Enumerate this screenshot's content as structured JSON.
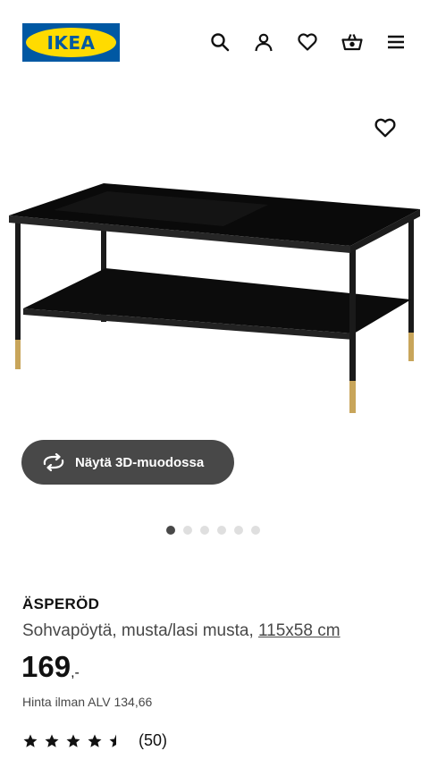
{
  "header": {
    "logo_text": "IKEA",
    "icons": [
      "search-icon",
      "profile-icon",
      "heart-icon",
      "basket-icon",
      "menu-icon"
    ]
  },
  "gallery": {
    "image_alt": "ÄSPERÖD Sohvapöytä, musta/lasi musta",
    "view_3d_label": "Näytä 3D-muodossa",
    "dots_total": 6,
    "dots_active": 1
  },
  "product": {
    "name": "ÄSPERÖD",
    "description": "Sohvapöytä, musta/lasi musta, ",
    "size_link": "115x58 cm",
    "price_main": "169",
    "price_suffix": ",-",
    "vat_text": "Hinta ilman ALV 134,66",
    "rating": 4.5,
    "review_count": "(50)"
  },
  "colors": {
    "brand_blue": "#0058a3",
    "brand_yellow": "#ffdb00",
    "button_dark": "#484848"
  }
}
